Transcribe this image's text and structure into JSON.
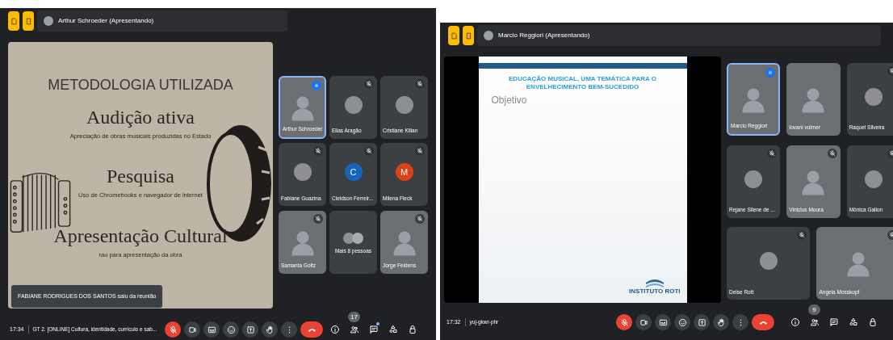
{
  "meetings": [
    {
      "presenter": "Arthur Schroeder (Apresentando)",
      "slide": {
        "kind": "metodologia",
        "title": "METODOLOGIA UTILIZADA",
        "sections": [
          {
            "heading": "Audição ativa",
            "text": "Apreciação de obras musicais produzidas no Estado"
          },
          {
            "heading": "Pesquisa",
            "text": "Uso de Chromebooks e navegador de internet"
          },
          {
            "heading": "Apresentação Cultural",
            "text": "rau para apresentação da obra"
          }
        ]
      },
      "toast": "FABIANE RODRIGUES DOS SANTOS saiu da reunião",
      "tiles": [
        {
          "name": "Arthur Schroeder",
          "kind": "video",
          "muted": false,
          "speaking": true
        },
        {
          "name": "Elias Aragão",
          "kind": "avatar",
          "muted": true,
          "speaking": false
        },
        {
          "name": "Cristiane Kilian",
          "kind": "avatar",
          "muted": true,
          "speaking": false
        },
        {
          "name": "Fabiane Guazina",
          "kind": "avatar",
          "muted": true,
          "speaking": false
        },
        {
          "name": "Cleidson Ferreir...",
          "kind": "letter",
          "letter": "C",
          "color": "#1565c0",
          "muted": true,
          "speaking": false
        },
        {
          "name": "Milena Fleck",
          "kind": "letter",
          "letter": "M",
          "color": "#d84315",
          "muted": true,
          "speaking": false
        },
        {
          "name": "Samanta Goltz",
          "kind": "video",
          "muted": true,
          "speaking": false
        },
        {
          "name": "Mais 8 pessoas",
          "kind": "more",
          "muted": false,
          "speaking": false
        },
        {
          "name": "Jorge Feldens",
          "kind": "video",
          "muted": true,
          "speaking": false
        }
      ],
      "clock": "17:34",
      "meeting_name": "GT 2. [ONLINE] Cultura, identidade, currículo e sab...",
      "mic_muted": true,
      "people_count": "17",
      "chat_unread": true
    },
    {
      "presenter": "Marcio Reggiori (Apresentando)",
      "slide": {
        "kind": "objetivo",
        "title": "EDUCAÇÃO MUSICAL, UMA TEMÁTICA PARA O ENVELHECIMENTO BEM-SUCEDIDO",
        "subtitle": "Objetivo",
        "logo": "INSTITUTO ROTI"
      },
      "tiles": [
        {
          "name": "Marcio Reggiori",
          "kind": "video",
          "muted": false,
          "speaking": true
        },
        {
          "name": "Iovani volmer",
          "kind": "video",
          "muted": false,
          "speaking": false
        },
        {
          "name": "Raquel Silveira",
          "kind": "avatar",
          "muted": true,
          "speaking": false
        },
        {
          "name": "Rejane Silene de ...",
          "kind": "avatar",
          "muted": true,
          "speaking": false
        },
        {
          "name": "Vinicius Moura",
          "kind": "video",
          "muted": true,
          "speaking": false
        },
        {
          "name": "Mônica Gallon",
          "kind": "avatar",
          "muted": true,
          "speaking": false
        },
        {
          "name": "Deise Rott",
          "kind": "avatar",
          "muted": true,
          "speaking": false
        },
        {
          "name": "Angela Mosskopf",
          "kind": "video",
          "muted": true,
          "speaking": false
        }
      ],
      "clock": "17:32",
      "meeting_name": "yuj-gkwr-phr",
      "mic_muted": true,
      "people_count": "9",
      "chat_unread": false
    }
  ]
}
